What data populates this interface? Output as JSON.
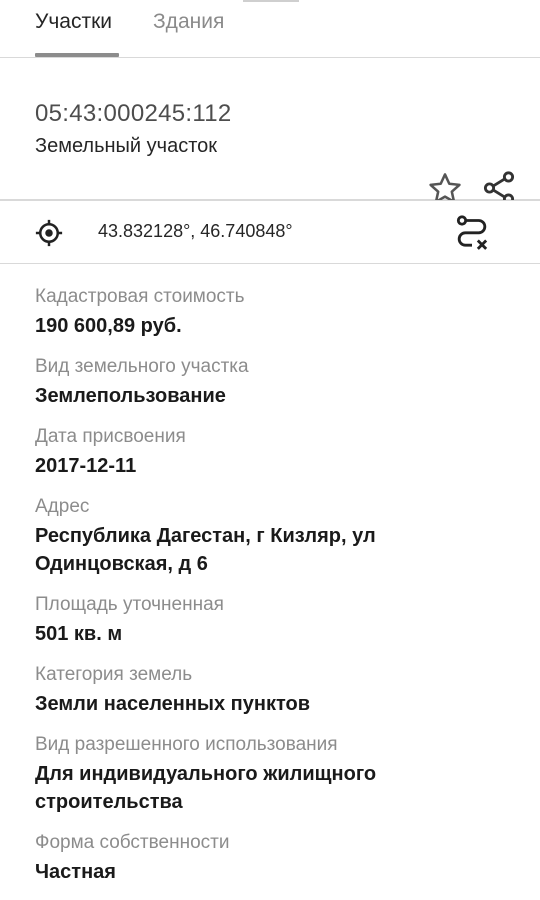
{
  "tabs": [
    {
      "label": "Участки",
      "active": true
    },
    {
      "label": "Здания",
      "active": false
    }
  ],
  "header": {
    "cadastral_number": "05:43:000245:112",
    "property_type": "Земельный участок"
  },
  "location": {
    "coordinates": "43.832128°, 46.740848°"
  },
  "details": [
    {
      "label": "Кадастровая стоимость",
      "value": "190 600,89 руб."
    },
    {
      "label": "Вид земельного участка",
      "value": "Землепользование"
    },
    {
      "label": "Дата присвоения",
      "value": "2017-12-11"
    },
    {
      "label": "Адрес",
      "value": "Республика Дагестан, г Кизляр, ул Одинцовская, д 6"
    },
    {
      "label": "Площадь уточненная",
      "value": "501 кв. м"
    },
    {
      "label": "Категория земель",
      "value": "Земли населенных пунктов"
    },
    {
      "label": "Вид разрешенного использования",
      "value": "Для индивидуального жилищного строительства"
    },
    {
      "label": "Форма собственности",
      "value": "Частная"
    }
  ],
  "colors": {
    "text_primary": "#1a1a1a",
    "text_secondary": "#8c8c8c",
    "divider": "#d9d9d9",
    "tab_indicator": "#8c8c8c"
  },
  "icons": [
    "star-icon",
    "share-icon",
    "location-target-icon",
    "route-cancel-icon"
  ]
}
